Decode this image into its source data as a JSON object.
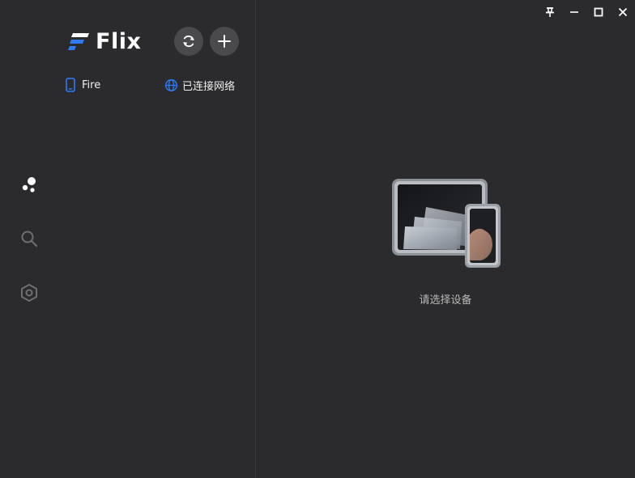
{
  "app": {
    "name": "Flix"
  },
  "window_controls": [
    "pin-icon",
    "minimize-icon",
    "maximize-icon",
    "close-icon"
  ],
  "rail": {
    "items": [
      {
        "icon": "devices-dots-icon",
        "active": true
      },
      {
        "icon": "search-icon",
        "active": false
      },
      {
        "icon": "settings-hex-icon",
        "active": false
      }
    ]
  },
  "header": {
    "refresh_icon": "refresh-icon",
    "add_icon": "plus-icon"
  },
  "device": {
    "name": "Fire",
    "network_status": "已连接网络"
  },
  "main": {
    "empty_message": "请选择设备"
  },
  "colors": {
    "background": "#2b2b2d",
    "accent": "#2f7cf6",
    "button_bg": "#4a4a4d"
  }
}
